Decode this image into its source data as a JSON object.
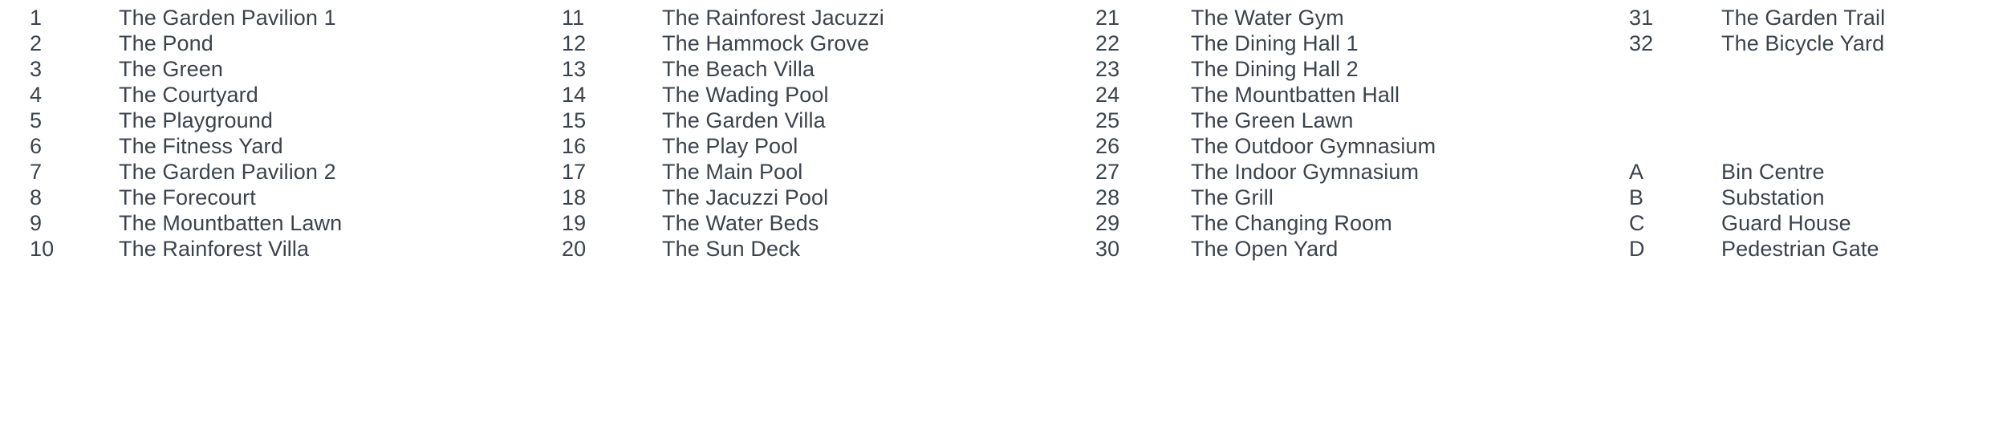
{
  "legend": {
    "background_color": "#ffffff",
    "text_color": "#3b434e",
    "columns": [
      {
        "name": "column-1",
        "rows": [
          {
            "key": "1",
            "label": "The Garden Pavilion 1",
            "row_index": 0
          },
          {
            "key": "2",
            "label": "The Pond",
            "row_index": 1
          },
          {
            "key": "3",
            "label": "The Green",
            "row_index": 2
          },
          {
            "key": "4",
            "label": "The Courtyard",
            "row_index": 3
          },
          {
            "key": "5",
            "label": "The Playground",
            "row_index": 4
          },
          {
            "key": "6",
            "label": "The Fitness Yard",
            "row_index": 5
          },
          {
            "key": "7",
            "label": "The Garden Pavilion 2",
            "row_index": 6
          },
          {
            "key": "8",
            "label": "The Forecourt",
            "row_index": 7
          },
          {
            "key": "9",
            "label": "The Mountbatten Lawn",
            "row_index": 8
          },
          {
            "key": "10",
            "label": "The Rainforest Villa",
            "row_index": 9
          }
        ]
      },
      {
        "name": "column-2",
        "rows": [
          {
            "key": "11",
            "label": "The Rainforest Jacuzzi",
            "row_index": 0
          },
          {
            "key": "12",
            "label": "The Hammock Grove",
            "row_index": 1
          },
          {
            "key": "13",
            "label": "The Beach Villa",
            "row_index": 2
          },
          {
            "key": "14",
            "label": "The Wading Pool",
            "row_index": 3
          },
          {
            "key": "15",
            "label": "The Garden Villa",
            "row_index": 4
          },
          {
            "key": "16",
            "label": "The Play Pool",
            "row_index": 5
          },
          {
            "key": "17",
            "label": "The Main Pool",
            "row_index": 6
          },
          {
            "key": "18",
            "label": "The Jacuzzi Pool",
            "row_index": 7
          },
          {
            "key": "19",
            "label": "The Water Beds",
            "row_index": 8
          },
          {
            "key": "20",
            "label": "The Sun Deck",
            "row_index": 9
          }
        ]
      },
      {
        "name": "column-3",
        "rows": [
          {
            "key": "21",
            "label": "The Water Gym",
            "row_index": 0
          },
          {
            "key": "22",
            "label": "The Dining Hall 1",
            "row_index": 1
          },
          {
            "key": "23",
            "label": "The Dining Hall 2",
            "row_index": 2
          },
          {
            "key": "24",
            "label": "The Mountbatten Hall",
            "row_index": 3
          },
          {
            "key": "25",
            "label": "The Green Lawn",
            "row_index": 4
          },
          {
            "key": "26",
            "label": "The Outdoor Gymnasium",
            "row_index": 5
          },
          {
            "key": "27",
            "label": "The Indoor Gymnasium",
            "row_index": 6
          },
          {
            "key": "28",
            "label": "The Grill",
            "row_index": 7
          },
          {
            "key": "29",
            "label": "The Changing Room",
            "row_index": 8
          },
          {
            "key": "30",
            "label": "The Open Yard",
            "row_index": 9
          }
        ]
      },
      {
        "name": "column-4",
        "rows": [
          {
            "key": "31",
            "label": "The Garden Trail",
            "row_index": 0
          },
          {
            "key": "32",
            "label": "The Bicycle Yard",
            "row_index": 1
          },
          {
            "key": "A",
            "label": "Bin Centre",
            "row_index": 6
          },
          {
            "key": "B",
            "label": "Substation",
            "row_index": 7
          },
          {
            "key": "C",
            "label": "Guard House",
            "row_index": 8
          },
          {
            "key": "D",
            "label": "Pedestrian Gate",
            "row_index": 9
          }
        ]
      }
    ]
  }
}
